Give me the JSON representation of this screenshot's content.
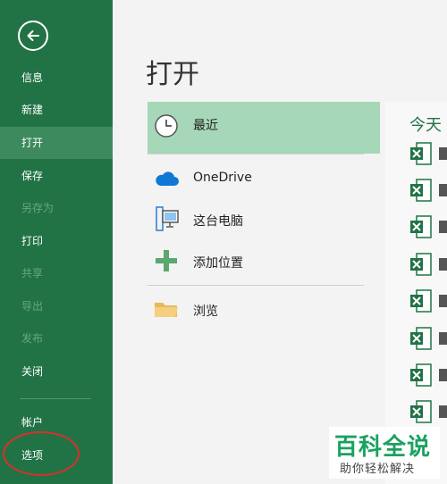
{
  "sidebar": {
    "back_icon": "back-arrow-icon",
    "items": [
      {
        "label": "信息",
        "state": "normal"
      },
      {
        "label": "新建",
        "state": "normal"
      },
      {
        "label": "打开",
        "state": "active"
      },
      {
        "label": "保存",
        "state": "normal"
      },
      {
        "label": "另存为",
        "state": "disabled"
      },
      {
        "label": "打印",
        "state": "normal"
      },
      {
        "label": "共享",
        "state": "disabled"
      },
      {
        "label": "导出",
        "state": "disabled"
      },
      {
        "label": "发布",
        "state": "disabled"
      },
      {
        "label": "关闭",
        "state": "normal"
      }
    ],
    "bottom_items": [
      {
        "label": "帐户"
      },
      {
        "label": "选项"
      }
    ],
    "colors": {
      "background": "#217346",
      "active": "#3d8a5e",
      "highlight_circle": "#d9302b"
    }
  },
  "main": {
    "title": "打开",
    "locations": [
      {
        "label": "最近",
        "icon": "clock-icon",
        "selected": true
      },
      {
        "label": "OneDrive",
        "icon": "cloud-icon",
        "selected": false
      },
      {
        "label": "这台电脑",
        "icon": "computer-icon",
        "selected": false
      },
      {
        "label": "添加位置",
        "icon": "plus-icon",
        "selected": false
      },
      {
        "label": "浏览",
        "icon": "folder-icon",
        "selected": false
      }
    ],
    "recent": {
      "group_label": "今天",
      "file_icon": "excel-file-icon"
    }
  },
  "watermark": {
    "title": "百科全说",
    "subtitle": "助你轻松解决"
  }
}
